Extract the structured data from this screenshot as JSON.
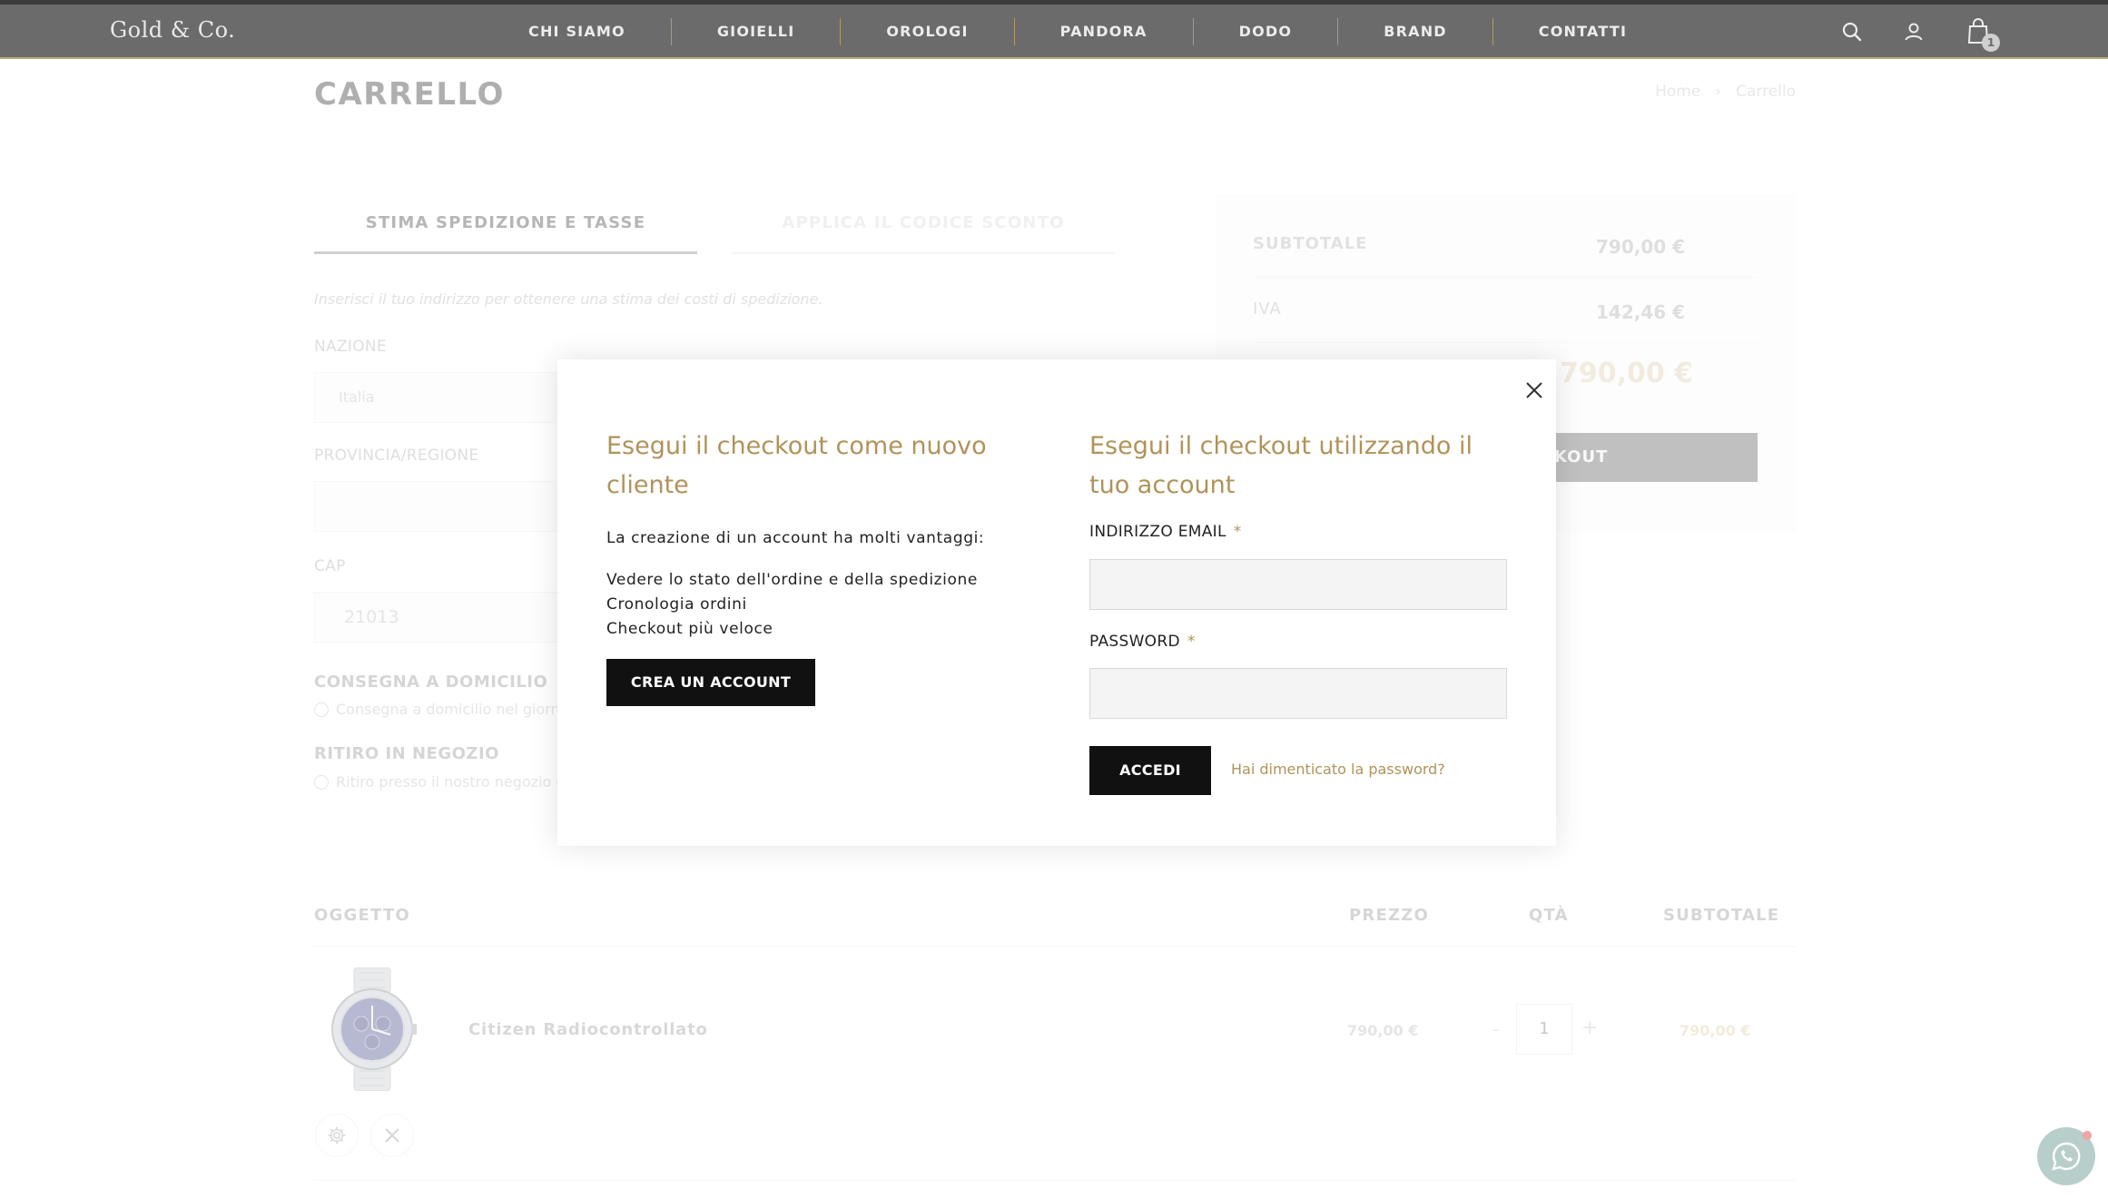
{
  "header": {
    "logo": "Gold & Co.",
    "nav": [
      "CHI SIAMO",
      "GIOIELLI",
      "OROLOGI",
      "PANDORA",
      "DODO",
      "BRAND",
      "CONTATTI"
    ],
    "cart_count": "1"
  },
  "page": {
    "title": "CARRELLO",
    "breadcrumb": {
      "home": "Home",
      "separator": "›",
      "current": "Carrello"
    }
  },
  "shipping": {
    "tab_estimate": "STIMA SPEDIZIONE E TASSE",
    "tab_discount": "APPLICA IL CODICE SCONTO",
    "hint": "Inserisci il tuo indirizzo per ottenere una stima dei costi di spedizione.",
    "country_label": "NAZIONE",
    "country_value": "Italia",
    "region_label": "PROVINCIA/REGIONE",
    "region_value": "",
    "zip_label": "CAP",
    "zip_value": "21013",
    "home_delivery_title": "CONSEGNA A DOMICILIO",
    "home_delivery_option": "Consegna a domicilio nel giorno c",
    "store_pickup_title": "RITIRO IN NEGOZIO",
    "store_pickup_option": "Ritiro presso il nostro negozio di"
  },
  "summary": {
    "subtotal_label": "SUBTOTALE",
    "subtotal_value": "790,00 €",
    "tax_label": "IVA",
    "tax_value": "142,46 €",
    "total_value": "790,00 €",
    "checkout_label": "KOUT"
  },
  "cart_table": {
    "col_item": "OGGETTO",
    "col_price": "PREZZO",
    "col_qty": "QTÀ",
    "col_subtotal": "SUBTOTALE",
    "items": [
      {
        "name": "Citizen Radiocontrollato",
        "price": "790,00 €",
        "qty": "1",
        "subtotal": "790,00 €",
        "minus": "-",
        "plus": "+"
      }
    ]
  },
  "modal": {
    "guest_title": "Esegui il checkout come nuovo cliente",
    "benefits_intro": "La creazione di un account ha molti vantaggi:",
    "benefits": [
      "Vedere lo stato dell'ordine e della spedizione",
      "Cronologia ordini",
      "Checkout più veloce"
    ],
    "create_account": "CREA UN ACCOUNT",
    "login_title": "Esegui il checkout utilizzando il tuo account",
    "email_label": "INDIRIZZO EMAIL",
    "password_label": "PASSWORD",
    "required_mark": "*",
    "email_value": "",
    "password_value": "",
    "login_button": "ACCEDI",
    "forgot_password": "Hai dimenticato la password?"
  },
  "colors": {
    "header_bg": "#6b6b6b",
    "gold_accent": "#b0935a",
    "button_dark": "#111111",
    "whatsapp": "#7fa79f"
  },
  "icons": [
    "search-icon",
    "user-icon",
    "cart-icon",
    "close-icon",
    "gear-icon",
    "remove-icon",
    "whatsapp-icon"
  ]
}
